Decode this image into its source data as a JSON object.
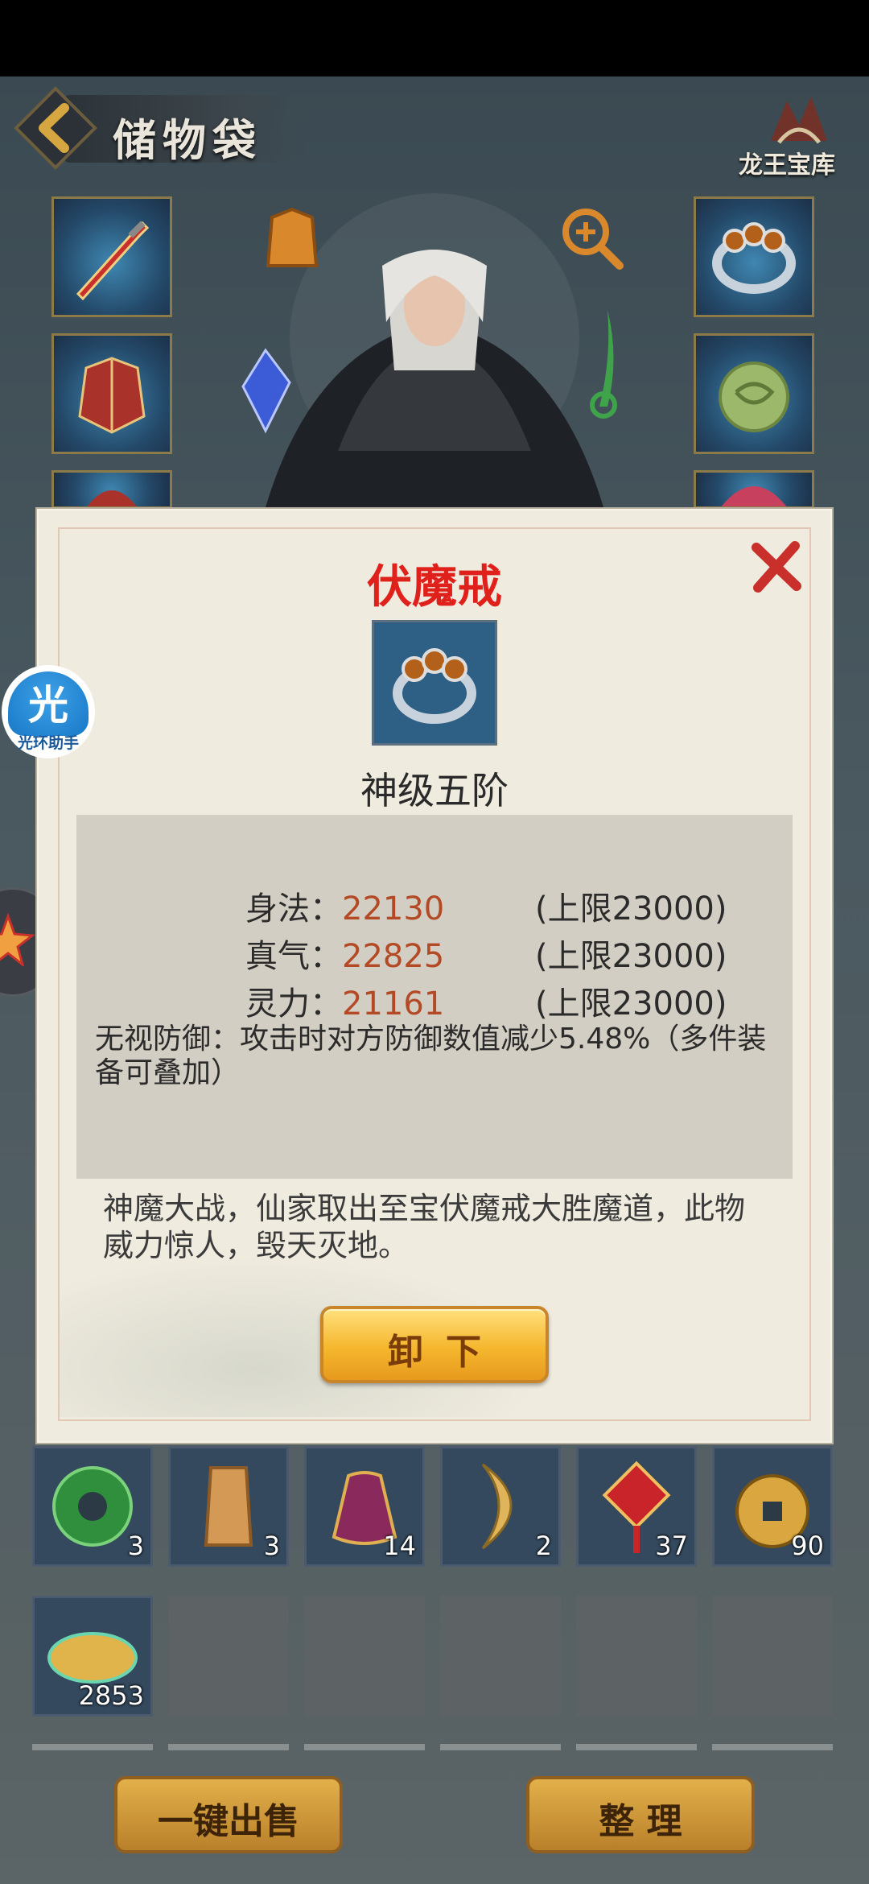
{
  "header": {
    "title": "储物袋",
    "treasury_label": "龙王宝库"
  },
  "equipment_slots": {
    "left": [
      "weapon-sword",
      "armor-robe",
      "helmet-partial"
    ],
    "right": [
      "ring",
      "jade-pendant",
      "orb-partial"
    ]
  },
  "item_popup": {
    "name": "伏魔戒",
    "grade": "神级五阶",
    "stats": [
      {
        "label": "身法：",
        "value": "22130",
        "cap": "(上限23000)"
      },
      {
        "label": "真气：",
        "value": "22825",
        "cap": "(上限23000)"
      },
      {
        "label": "灵力：",
        "value": "21161",
        "cap": "(上限23000)"
      }
    ],
    "special": "无视防御：攻击时对方防御数值减少5.48%（多件装备可叠加）",
    "lore": "神魔大战，仙家取出至宝伏魔戒大胜魔道，此物威力惊人，毁天灭地。",
    "unequip_label": "卸下"
  },
  "floating_helper": {
    "label": "光环助手",
    "glyph": "光"
  },
  "inventory": [
    {
      "icon": "green-jade-orb",
      "qty": "3"
    },
    {
      "icon": "bronze-talisman",
      "qty": "3"
    },
    {
      "icon": "purple-pouch",
      "qty": "14"
    },
    {
      "icon": "crescent-horn",
      "qty": "2"
    },
    {
      "icon": "red-knot-charm",
      "qty": "37"
    },
    {
      "icon": "copper-coin",
      "qty": "90"
    },
    {
      "icon": "golden-cloud",
      "qty": "2853"
    }
  ],
  "footer": {
    "sell_all_label": "一键出售",
    "sort_label": "整 理"
  },
  "colors": {
    "item_name": "#e0201a",
    "stat_value": "#b34a25",
    "button_gold": "#f5b72e"
  }
}
